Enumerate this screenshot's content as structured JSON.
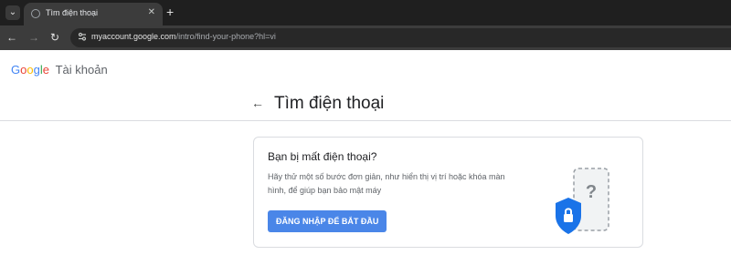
{
  "browser": {
    "tab_title": "Tìm điện thoại",
    "tab_close_icon": "close-icon",
    "url_host": "myaccount.google.com",
    "url_path": "/intro/find-your-phone?hl=vi",
    "icons": [
      "tab-search-icon",
      "back-icon",
      "forward-icon",
      "reload-icon",
      "site-info-icon",
      "new-tab-icon"
    ]
  },
  "header": {
    "logo": {
      "g1": "G",
      "g2": "o",
      "g3": "o",
      "g4": "g",
      "g5": "l",
      "g6": "e"
    },
    "product": "Tài khoản"
  },
  "main": {
    "title": "Tìm điện thoại",
    "card": {
      "title": "Bạn bị mất điện thoại?",
      "description": "Hãy thử một số bước đơn giản, như hiển thị vị trí hoặc khóa màn hình, để giúp bạn bảo mật máy",
      "button_label": "ĐĂNG NHẬP ĐỂ BẮT ĐẦU"
    }
  },
  "colors": {
    "chrome_dark": "#1f1f1f",
    "toolbar": "#3c3c3c",
    "button_blue": "#4a86e8",
    "shield_blue": "#1a73e8"
  }
}
